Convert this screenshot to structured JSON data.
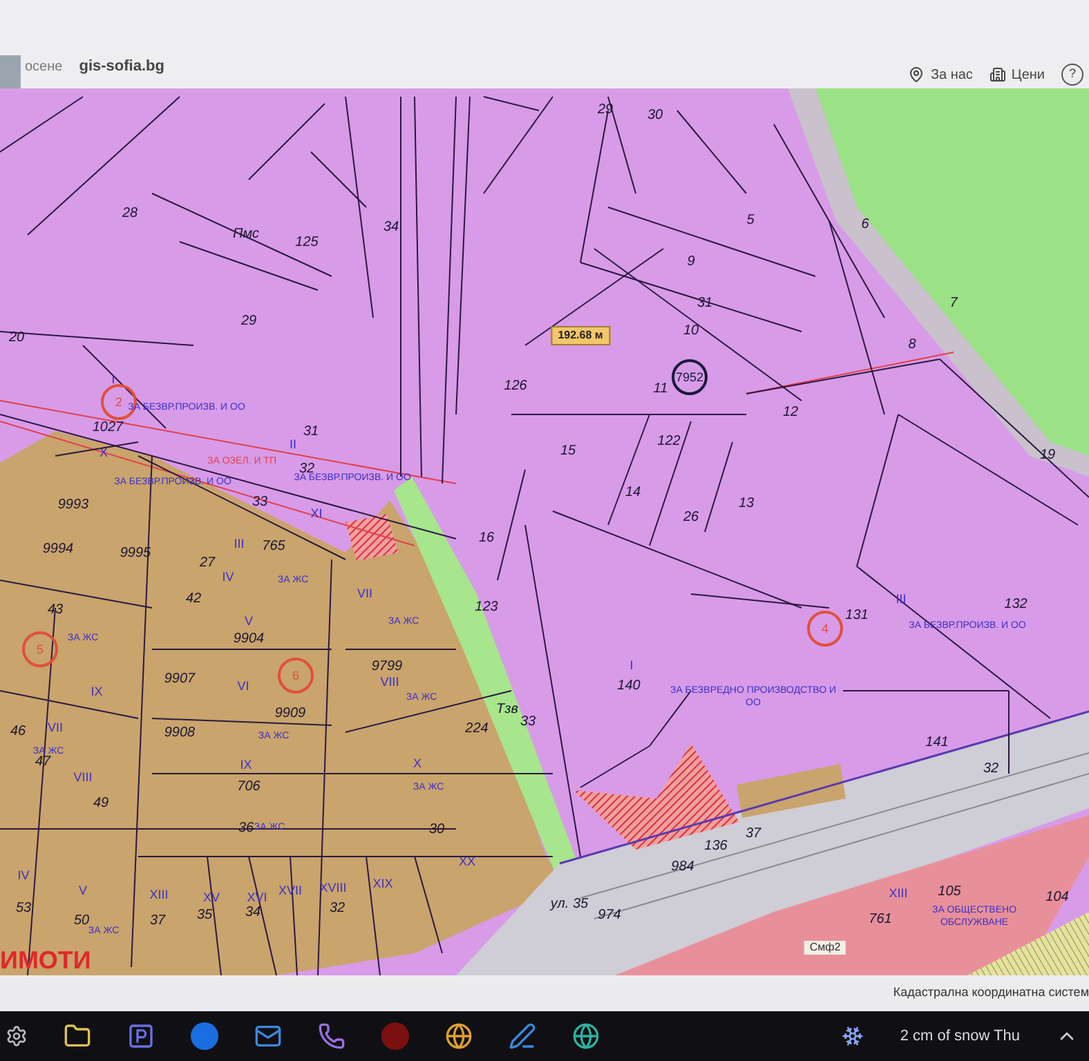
{
  "browser": {
    "tab_text": "осене",
    "site": "gis-sofia.bg"
  },
  "nav": [
    {
      "label": "За нас",
      "kind": "pin"
    },
    {
      "label": "Цени",
      "kind": "prices"
    },
    {
      "label": "?",
      "kind": "help"
    }
  ],
  "map": {
    "labels": [
      {
        "text": "29",
        "kind": "parcel"
      },
      {
        "text": "30",
        "kind": "parcel"
      },
      {
        "text": "28",
        "kind": "parcel"
      },
      {
        "text": "Пмс",
        "kind": "parcel"
      },
      {
        "text": "125",
        "kind": "parcel"
      },
      {
        "text": "34",
        "kind": "parcel"
      },
      {
        "text": "5",
        "kind": "parcel"
      },
      {
        "text": "6",
        "kind": "parcel"
      },
      {
        "text": "9",
        "kind": "parcel"
      },
      {
        "text": "31",
        "kind": "parcel"
      },
      {
        "text": "7",
        "kind": "parcel"
      },
      {
        "text": "20",
        "kind": "parcel"
      },
      {
        "text": "29",
        "kind": "parcel"
      },
      {
        "text": "10",
        "kind": "parcel"
      },
      {
        "text": "8",
        "kind": "parcel"
      },
      {
        "text": "126",
        "kind": "parcel"
      },
      {
        "text": "11",
        "kind": "parcel"
      },
      {
        "text": "12",
        "kind": "parcel"
      },
      {
        "text": "1027",
        "kind": "parcel"
      },
      {
        "text": "31",
        "kind": "parcel"
      },
      {
        "text": "15",
        "kind": "parcel"
      },
      {
        "text": "122",
        "kind": "parcel"
      },
      {
        "text": "19",
        "kind": "parcel"
      },
      {
        "text": "32",
        "kind": "parcel"
      },
      {
        "text": "9993",
        "kind": "parcel"
      },
      {
        "text": "33",
        "kind": "parcel"
      },
      {
        "text": "14",
        "kind": "parcel"
      },
      {
        "text": "26",
        "kind": "parcel"
      },
      {
        "text": "13",
        "kind": "parcel"
      },
      {
        "text": "9994",
        "kind": "parcel"
      },
      {
        "text": "9995",
        "kind": "parcel"
      },
      {
        "text": "27",
        "kind": "parcel"
      },
      {
        "text": "765",
        "kind": "parcel"
      },
      {
        "text": "16",
        "kind": "parcel"
      },
      {
        "text": "43",
        "kind": "parcel"
      },
      {
        "text": "42",
        "kind": "parcel"
      },
      {
        "text": "123",
        "kind": "parcel"
      },
      {
        "text": "131",
        "kind": "parcel"
      },
      {
        "text": "132",
        "kind": "parcel"
      },
      {
        "text": "9904",
        "kind": "parcel"
      },
      {
        "text": "9907",
        "kind": "parcel"
      },
      {
        "text": "9799",
        "kind": "parcel"
      },
      {
        "text": "140",
        "kind": "parcel"
      },
      {
        "text": "46",
        "kind": "parcel"
      },
      {
        "text": "9908",
        "kind": "parcel"
      },
      {
        "text": "9909",
        "kind": "parcel"
      },
      {
        "text": "224",
        "kind": "parcel"
      },
      {
        "text": "33",
        "kind": "parcel"
      },
      {
        "text": "141",
        "kind": "parcel"
      },
      {
        "text": "47",
        "kind": "parcel"
      },
      {
        "text": "32",
        "kind": "parcel"
      },
      {
        "text": "49",
        "kind": "parcel"
      },
      {
        "text": "706",
        "kind": "parcel"
      },
      {
        "text": "36",
        "kind": "parcel"
      },
      {
        "text": "30",
        "kind": "parcel"
      },
      {
        "text": "136",
        "kind": "parcel"
      },
      {
        "text": "37",
        "kind": "parcel"
      },
      {
        "text": "984",
        "kind": "parcel"
      },
      {
        "text": "53",
        "kind": "parcel"
      },
      {
        "text": "50",
        "kind": "parcel"
      },
      {
        "text": "37",
        "kind": "parcel"
      },
      {
        "text": "35",
        "kind": "parcel"
      },
      {
        "text": "34",
        "kind": "parcel"
      },
      {
        "text": "32",
        "kind": "parcel"
      },
      {
        "text": "974",
        "kind": "parcel"
      },
      {
        "text": "761",
        "kind": "parcel"
      },
      {
        "text": "105",
        "kind": "parcel"
      },
      {
        "text": "104",
        "kind": "parcel"
      },
      {
        "text": "Тзв",
        "kind": "parcel"
      },
      {
        "text": "ул. 35",
        "kind": "parcel"
      },
      {
        "text": "Смф2",
        "kind": "tag"
      },
      {
        "text": "192.68 м",
        "kind": "measure"
      },
      {
        "text": "7952",
        "kind": "circle",
        "color": "#1a1a3a"
      },
      {
        "text": "2",
        "kind": "circle",
        "color": "#e0503c"
      },
      {
        "text": "4",
        "kind": "circle",
        "color": "#e0503c"
      },
      {
        "text": "6",
        "kind": "circle",
        "color": "#e0503c"
      },
      {
        "text": "5",
        "kind": "circle",
        "color": "#e0503c"
      },
      {
        "text": "I",
        "kind": "roman"
      },
      {
        "text": "X",
        "kind": "roman"
      },
      {
        "text": "II",
        "kind": "roman"
      },
      {
        "text": "XI",
        "kind": "roman"
      },
      {
        "text": "III",
        "kind": "roman"
      },
      {
        "text": "IV",
        "kind": "roman"
      },
      {
        "text": "V",
        "kind": "roman"
      },
      {
        "text": "VII",
        "kind": "roman"
      },
      {
        "text": "IX",
        "kind": "roman"
      },
      {
        "text": "VI",
        "kind": "roman"
      },
      {
        "text": "VIII",
        "kind": "roman"
      },
      {
        "text": "VII",
        "kind": "roman"
      },
      {
        "text": "VIII",
        "kind": "roman"
      },
      {
        "text": "IX",
        "kind": "roman"
      },
      {
        "text": "X",
        "kind": "roman"
      },
      {
        "text": "IV",
        "kind": "roman"
      },
      {
        "text": "V",
        "kind": "roman"
      },
      {
        "text": "XIII",
        "kind": "roman"
      },
      {
        "text": "XV",
        "kind": "roman"
      },
      {
        "text": "XVI",
        "kind": "roman"
      },
      {
        "text": "XVII",
        "kind": "roman"
      },
      {
        "text": "XVIII",
        "kind": "roman"
      },
      {
        "text": "XIX",
        "kind": "roman"
      },
      {
        "text": "XX",
        "kind": "roman"
      },
      {
        "text": "III",
        "kind": "roman"
      },
      {
        "text": "I",
        "kind": "roman"
      },
      {
        "text": "XIII",
        "kind": "roman"
      },
      {
        "text": "ЗА БЕЗВР.ПРОИЗВ. И ОО",
        "kind": "zone"
      },
      {
        "text": "ЗА БЕЗВР.ПРОИЗВ. И ОО",
        "kind": "zone"
      },
      {
        "text": "ЗА БЕЗВР.ПРОИЗВ. И ОО",
        "kind": "zone"
      },
      {
        "text": "ЗА БЕЗВР.ПРОИЗВ. И ОО",
        "kind": "zone"
      },
      {
        "text": "ЗА БЕЗВРЕДНО ПРОИЗВОДСТВО И ОО",
        "kind": "zone"
      },
      {
        "text": "ЗА ОБЩЕСТВЕНО ОБСЛУЖВАНЕ",
        "kind": "zone"
      },
      {
        "text": "ЗА ЖС",
        "kind": "zone"
      },
      {
        "text": "ЗА ЖС",
        "kind": "zone"
      },
      {
        "text": "ЗА ЖС",
        "kind": "zone"
      },
      {
        "text": "ЗА ЖС",
        "kind": "zone"
      },
      {
        "text": "ЗА ЖС",
        "kind": "zone"
      },
      {
        "text": "ЗА ЖС",
        "kind": "zone"
      },
      {
        "text": "ЗА ЖС",
        "kind": "zone"
      },
      {
        "text": "ЗА ЖС",
        "kind": "zone"
      },
      {
        "text": "ЗА ЖС",
        "kind": "zone"
      },
      {
        "text": "ЗА ОЗЕЛ. И ТП",
        "kind": "zone_red"
      }
    ],
    "overlay_title": "ИМОТИ"
  },
  "status_bar": {
    "text": "Кадастрална координатна систем"
  },
  "taskbar": {
    "weather": "2 cm of snow Thu"
  }
}
